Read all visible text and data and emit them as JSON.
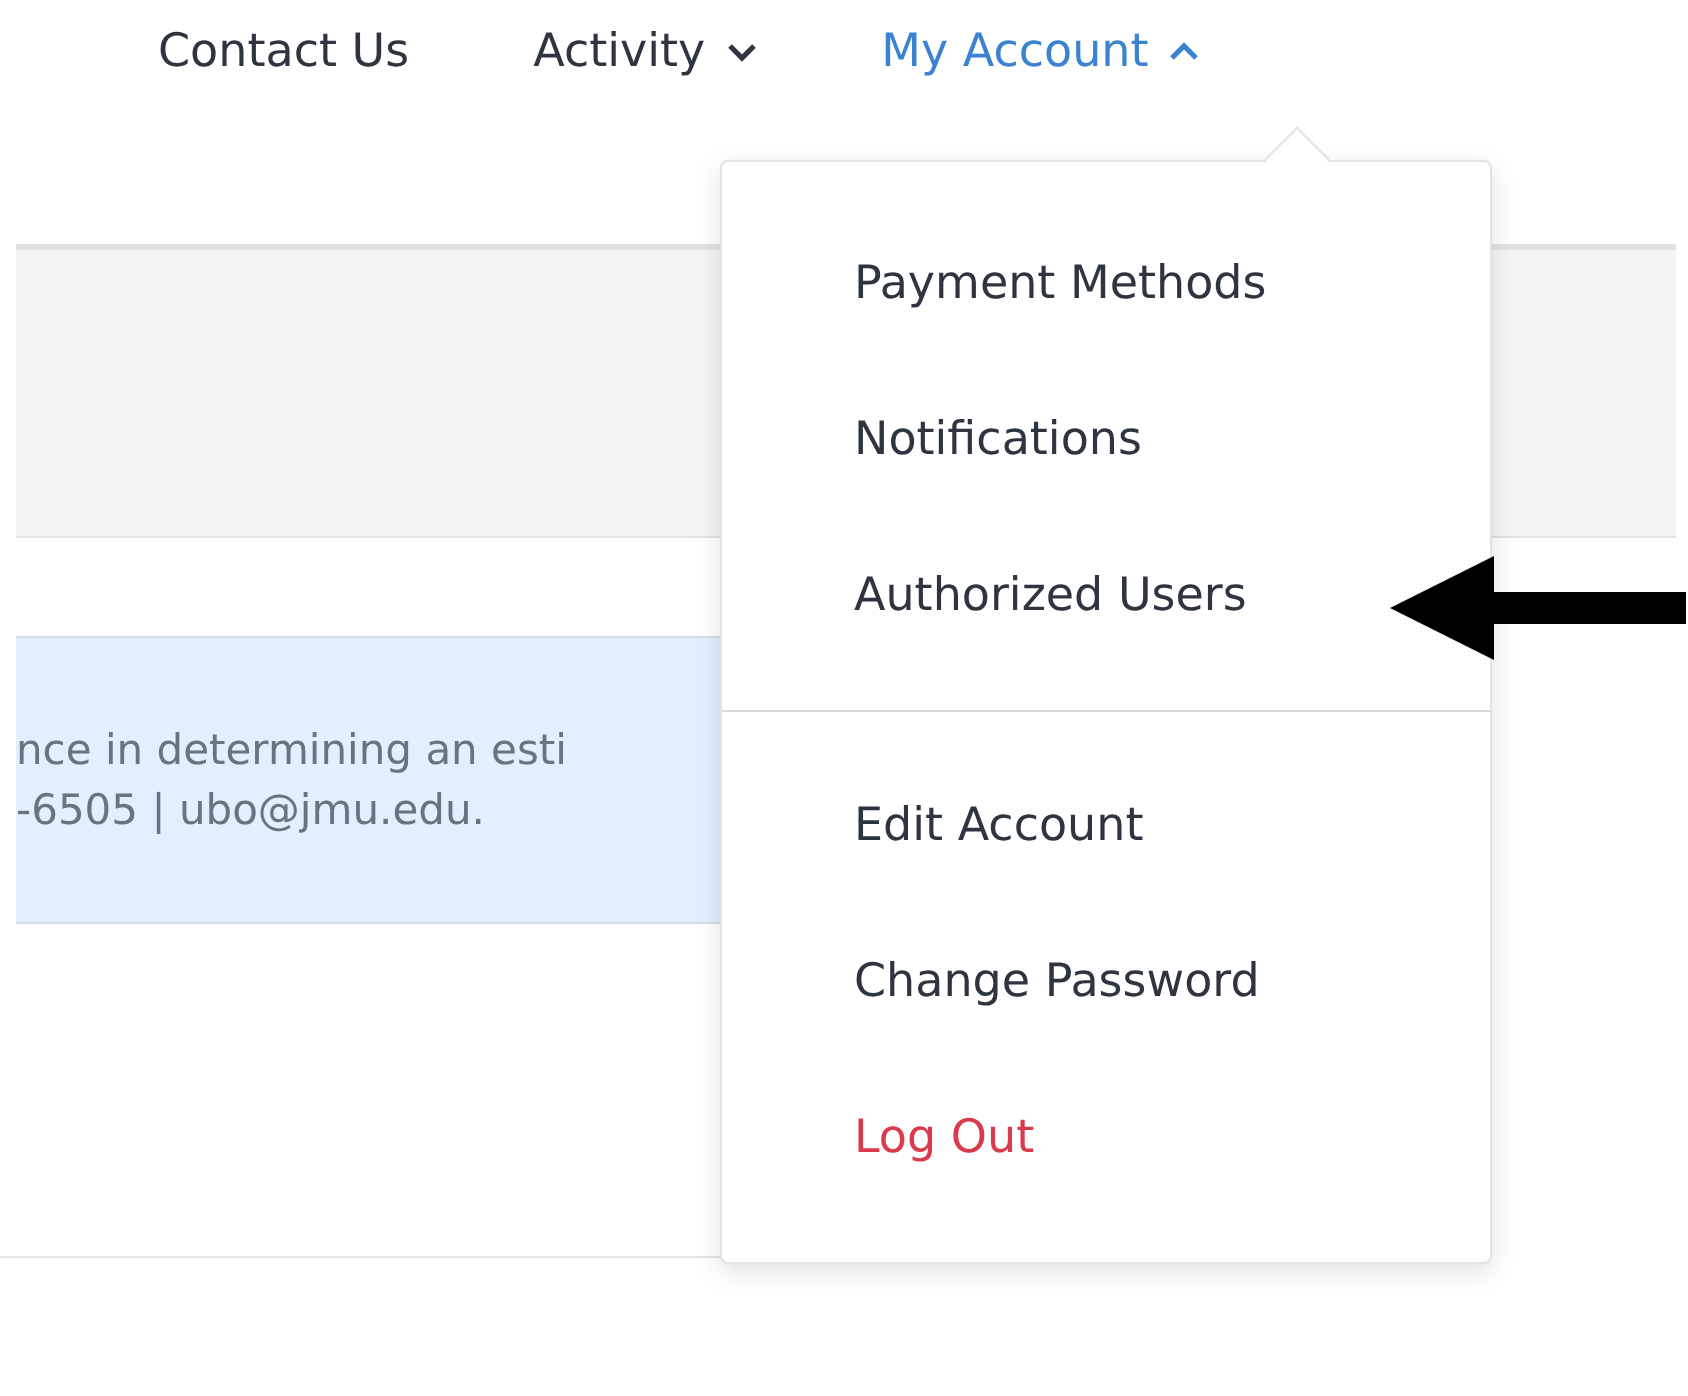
{
  "nav": [
    {
      "label": "Contact Us",
      "has_caret": false,
      "expanded": false
    },
    {
      "label": "Activity",
      "has_caret": true,
      "expanded": false
    },
    {
      "label": "My Account",
      "has_caret": true,
      "expanded": true
    }
  ],
  "notice": {
    "lines": [
      "nce in determining an esti",
      "-6505 | ubo@jmu.edu."
    ]
  },
  "menu": {
    "groups": [
      [
        {
          "label": "Payment Methods",
          "kind": "normal"
        },
        {
          "label": "Notifications",
          "kind": "normal"
        },
        {
          "label": "Authorized Users",
          "kind": "normal"
        }
      ],
      [
        {
          "label": "Edit Account",
          "kind": "normal"
        },
        {
          "label": "Change Password",
          "kind": "normal"
        },
        {
          "label": "Log Out",
          "kind": "danger"
        }
      ]
    ]
  }
}
